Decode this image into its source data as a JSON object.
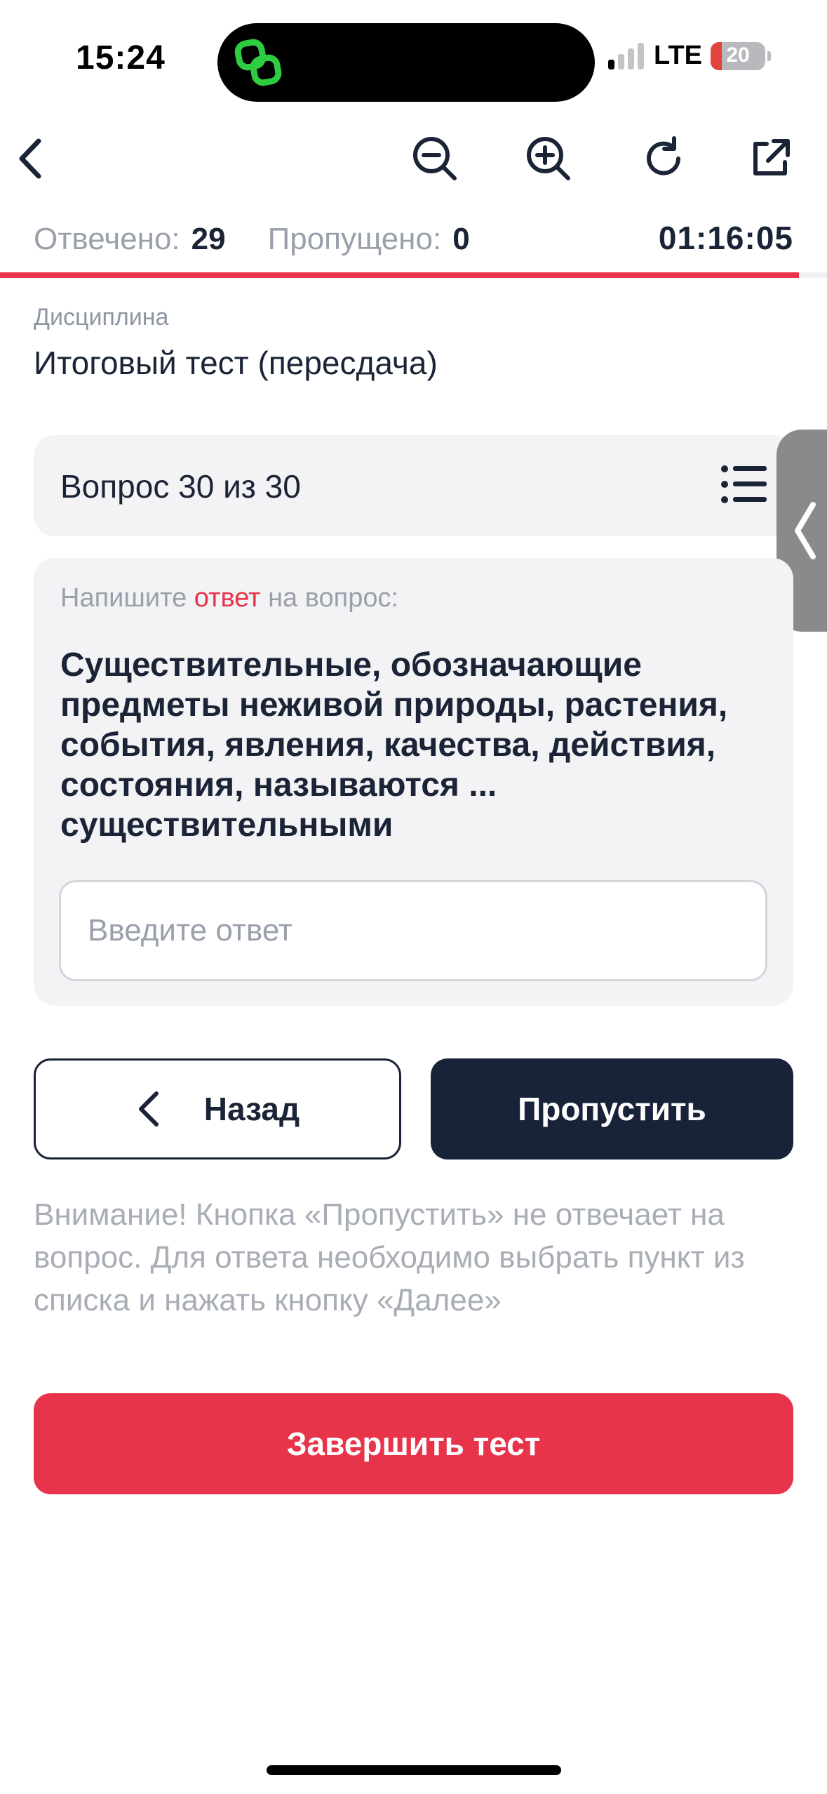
{
  "status_bar": {
    "time": "15:24",
    "network": "LTE",
    "battery_percent": "20",
    "battery_level": 0.2,
    "signal_bars_active": 1,
    "island_app_icon": "link-chain-icon",
    "island_app_color": "#2ecc40"
  },
  "toolbar": {
    "back_icon": "chevron-left-icon",
    "zoom_out_icon": "zoom-out-icon",
    "zoom_in_icon": "zoom-in-icon",
    "reload_icon": "reload-icon",
    "open_external_icon": "open-external-icon"
  },
  "stats": {
    "answered_label": "Отвечено:",
    "answered_value": "29",
    "skipped_label": "Пропущено:",
    "skipped_value": "0",
    "timer": "01:16:05",
    "progress": 0.966
  },
  "discipline": {
    "label": "Дисциплина",
    "title": "Итоговый тест (пересдача)"
  },
  "question_header": {
    "label": "Вопрос 30 из 30",
    "list_icon": "list-icon"
  },
  "side_tab": {
    "icon": "chevron-left-icon"
  },
  "question": {
    "prompt_before": "Напишите ",
    "prompt_accent": "ответ",
    "prompt_after": " на вопрос:",
    "text": "Существительные, обозначающие предметы неживой природы, растения, события, явления, качества, действия, состояния, называются ... существительными",
    "answer_value": "",
    "answer_placeholder": "Введите ответ"
  },
  "buttons": {
    "back_label": "Назад",
    "skip_label": "Пропустить",
    "finish_label": "Завершить тест"
  },
  "notice": "Внимание! Кнопка «Пропустить» не отвечает на вопрос. Для ответа необходимо выбрать пункт из списка и нажать кнопку «Далее»",
  "colors": {
    "accent_red": "#e8344a",
    "navy": "#182339",
    "text_dark": "#1b2436",
    "text_muted": "#9aa0ab",
    "card_bg": "#f3f3f5"
  }
}
